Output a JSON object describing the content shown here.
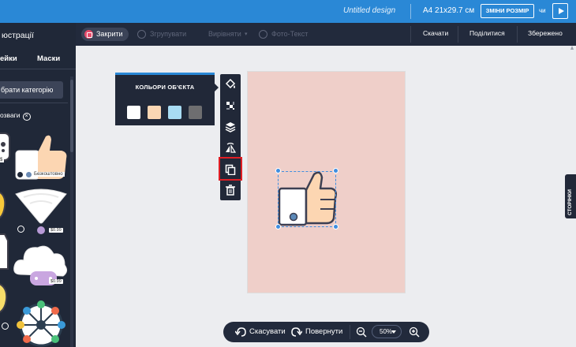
{
  "topbar": {
    "design_name": "Untitled design",
    "page_size": "A4 21x29.7 см",
    "resize_button": "ЗМІНИ РОЗМІР",
    "or_label": "чи"
  },
  "toolbar": {
    "close": "Закрити",
    "group": "Згрупувати",
    "align": "Вирівняти",
    "photo_text": "Фото-Текст",
    "download": "Скачати",
    "share": "Поділитися",
    "save": "Збережено"
  },
  "sidebar": {
    "title": "юстрації",
    "tabs": [
      "ейки",
      "Маски"
    ],
    "category_button": "брати категорію",
    "filter_label": "озваги",
    "badges": {
      "free": "Безкоштовно",
      "price_1": "$0.99",
      "price_2": "$0.99"
    }
  },
  "colors_popup": {
    "title": "КОЛЬОРИ ОБ'ЄКТА",
    "swatches": [
      "#ffffff",
      "#fbd7b4",
      "#a8dcf3",
      "#6e6e70"
    ]
  },
  "side_tools": [
    "fill-color",
    "transparency",
    "layers",
    "flip",
    "duplicate",
    "delete"
  ],
  "right_tab": "СТОРІНКИ",
  "bottombar": {
    "undo": "Скасувати",
    "redo": "Повернути",
    "zoom": "50%"
  },
  "colors": {
    "accent": "#2a88d6",
    "highlight": "#e01e24",
    "page_background": "#efcfc9"
  }
}
